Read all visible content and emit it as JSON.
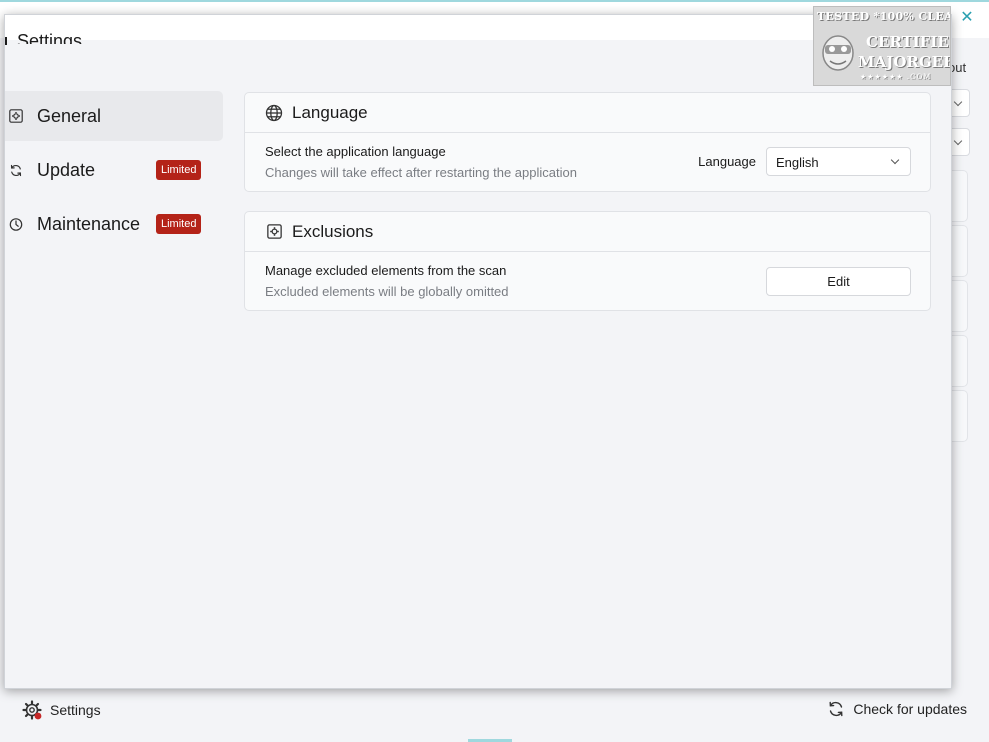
{
  "background": {
    "close_glyph": "✕",
    "about_fragment": "out",
    "footer": {
      "settings_label": "Settings",
      "updates_label": "Check for updates"
    }
  },
  "dialog": {
    "title": "Settings",
    "nav": [
      {
        "label": "General",
        "icon": "gear-square-icon",
        "active": true
      },
      {
        "label": "Update",
        "icon": "refresh-icon",
        "badge": "Limited"
      },
      {
        "label": "Maintenance",
        "icon": "clock-icon",
        "badge": "Limited"
      }
    ],
    "language_card": {
      "title": "Language",
      "row_title": "Select the application language",
      "row_desc": "Changes will take effect after restarting the application",
      "field_label": "Language",
      "selected": "English"
    },
    "exclusions_card": {
      "title": "Exclusions",
      "row_title": "Manage excluded elements from the scan",
      "row_desc": "Excluded elements will be globally omitted",
      "button_label": "Edit"
    }
  },
  "watermark": {
    "line1": "TESTED *100% CLEAN",
    "line2": "CERTIFIED",
    "line3": "MAJORGEEKS",
    "line4": "★★★★★★ .COM"
  },
  "colors": {
    "badge": "#b42318",
    "accent": "#9fd8de"
  }
}
